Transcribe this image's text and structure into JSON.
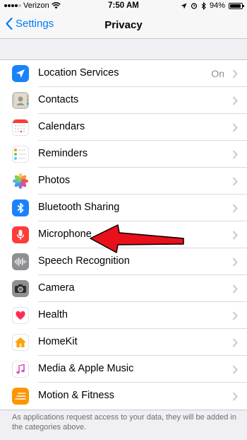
{
  "status_bar": {
    "carrier": "Verizon",
    "time": "7:50 AM",
    "battery": "94%",
    "battery_level": 0.94
  },
  "nav": {
    "back_label": "Settings",
    "title": "Privacy"
  },
  "rows": [
    {
      "label": "Location Services",
      "detail": "On",
      "icon": "location-arrow-icon",
      "color": "#1a82fb"
    },
    {
      "label": "Contacts",
      "detail": "",
      "icon": "contacts-icon",
      "color": "#c9c4b9"
    },
    {
      "label": "Calendars",
      "detail": "",
      "icon": "calendar-icon",
      "color": "#ffffff"
    },
    {
      "label": "Reminders",
      "detail": "",
      "icon": "reminders-list-icon",
      "color": "#ffffff"
    },
    {
      "label": "Photos",
      "detail": "",
      "icon": "photos-flower-icon",
      "color": "#ffffff"
    },
    {
      "label": "Bluetooth Sharing",
      "detail": "",
      "icon": "bluetooth-icon",
      "color": "#1a82fb"
    },
    {
      "label": "Microphone",
      "detail": "",
      "icon": "microphone-icon",
      "color": "#fc3d39"
    },
    {
      "label": "Speech Recognition",
      "detail": "",
      "icon": "waveform-icon",
      "color": "#8e8e93"
    },
    {
      "label": "Camera",
      "detail": "",
      "icon": "camera-icon",
      "color": "#8e8e93"
    },
    {
      "label": "Health",
      "detail": "",
      "icon": "heart-icon",
      "color": "#ffffff"
    },
    {
      "label": "HomeKit",
      "detail": "",
      "icon": "home-icon",
      "color": "#ffffff"
    },
    {
      "label": "Media & Apple Music",
      "detail": "",
      "icon": "music-note-icon",
      "color": "#ffffff"
    },
    {
      "label": "Motion & Fitness",
      "detail": "",
      "icon": "motion-fitness-icon",
      "color": "#ff9500"
    }
  ],
  "footer_text": "As applications request access to your data, they will be added in the categories above.",
  "annotation": {
    "arrow_color": "#e8101a",
    "points_to": "Microphone"
  }
}
